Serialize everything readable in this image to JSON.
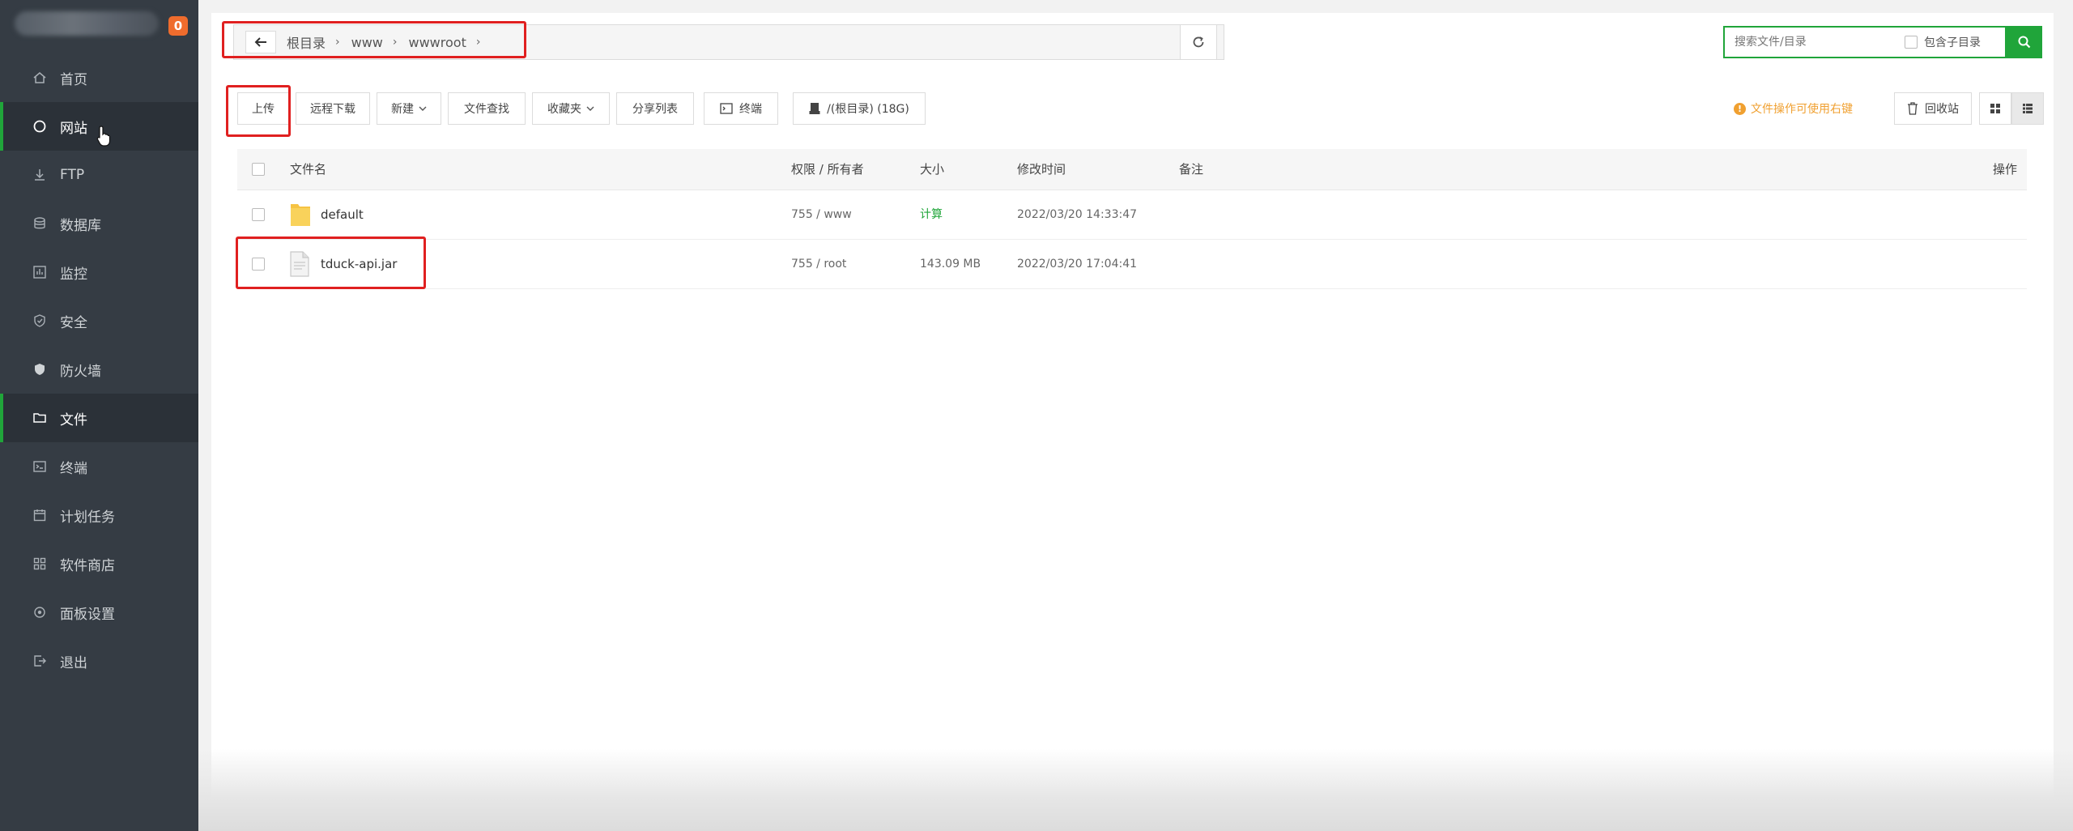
{
  "sidebar": {
    "badge": "0",
    "items": [
      {
        "label": "首页",
        "icon": "home-icon"
      },
      {
        "label": "网站",
        "icon": "globe-icon"
      },
      {
        "label": "FTP",
        "icon": "ftp-icon"
      },
      {
        "label": "数据库",
        "icon": "database-icon"
      },
      {
        "label": "监控",
        "icon": "monitor-icon"
      },
      {
        "label": "安全",
        "icon": "shield-icon"
      },
      {
        "label": "防火墙",
        "icon": "firewall-icon"
      },
      {
        "label": "文件",
        "icon": "folder-icon"
      },
      {
        "label": "终端",
        "icon": "terminal-icon"
      },
      {
        "label": "计划任务",
        "icon": "calendar-icon"
      },
      {
        "label": "软件商店",
        "icon": "grid-icon"
      },
      {
        "label": "面板设置",
        "icon": "settings-icon"
      },
      {
        "label": "退出",
        "icon": "logout-icon"
      }
    ]
  },
  "path": {
    "crumbs": [
      "根目录",
      "www",
      "wwwroot"
    ]
  },
  "search": {
    "placeholder": "搜索文件/目录",
    "include_sub_label": "包含子目录"
  },
  "toolbar": {
    "upload": "上传",
    "remote_download": "远程下载",
    "new": "新建",
    "file_search": "文件查找",
    "favorites": "收藏夹",
    "share_list": "分享列表",
    "terminal": "终端",
    "disk": "/(根目录) (18G)",
    "tip": "文件操作可使用右键",
    "recycle": "回收站"
  },
  "table": {
    "headers": {
      "name": "文件名",
      "perm": "权限 / 所有者",
      "size": "大小",
      "mtime": "修改时间",
      "note": "备注",
      "ops": "操作"
    },
    "rows": [
      {
        "name": "default",
        "type": "folder",
        "perm": "755 / www",
        "size": "计算",
        "mtime": "2022/03/20 14:33:47"
      },
      {
        "name": "tduck-api.jar",
        "type": "file",
        "perm": "755 / root",
        "size": "143.09 MB",
        "mtime": "2022/03/20 17:04:41"
      }
    ]
  },
  "colors": {
    "sidebar_bg": "#353c44",
    "accent_green": "#20a53a",
    "highlight_red": "#e02020",
    "tip_orange": "#f0a030"
  }
}
